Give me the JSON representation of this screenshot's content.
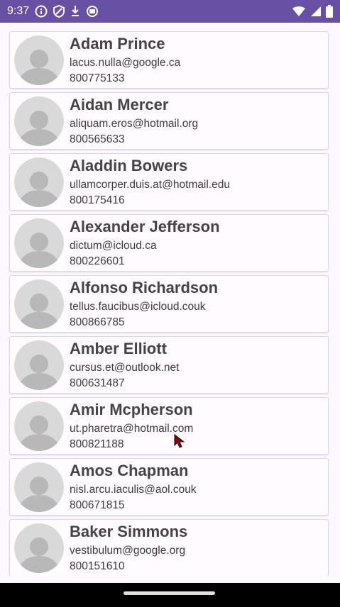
{
  "status_bar": {
    "time": "9:37",
    "left_icons": [
      "info-icon",
      "shield-icon",
      "download-icon",
      "sync-icon"
    ],
    "right_icons": [
      "wifi-icon",
      "signal-icon",
      "battery-icon"
    ],
    "background": "#6750a4"
  },
  "contacts": [
    {
      "name": "Adam Prince",
      "email": "lacus.nulla@google.ca",
      "phone": "800775133"
    },
    {
      "name": "Aidan Mercer",
      "email": "aliquam.eros@hotmail.org",
      "phone": "800565633"
    },
    {
      "name": "Aladdin Bowers",
      "email": "ullamcorper.duis.at@hotmail.edu",
      "phone": "800175416"
    },
    {
      "name": "Alexander Jefferson",
      "email": "dictum@icloud.ca",
      "phone": "800226601"
    },
    {
      "name": "Alfonso Richardson",
      "email": "tellus.faucibus@icloud.couk",
      "phone": "800866785"
    },
    {
      "name": "Amber Elliott",
      "email": "cursus.et@outlook.net",
      "phone": "800631487"
    },
    {
      "name": "Amir Mcpherson",
      "email": "ut.pharetra@hotmail.com",
      "phone": "800821188"
    },
    {
      "name": "Amos Chapman",
      "email": "nisl.arcu.iaculis@aol.couk",
      "phone": "800671815"
    },
    {
      "name": "Baker Simmons",
      "email": "vestibulum@google.org",
      "phone": "800151610"
    }
  ]
}
